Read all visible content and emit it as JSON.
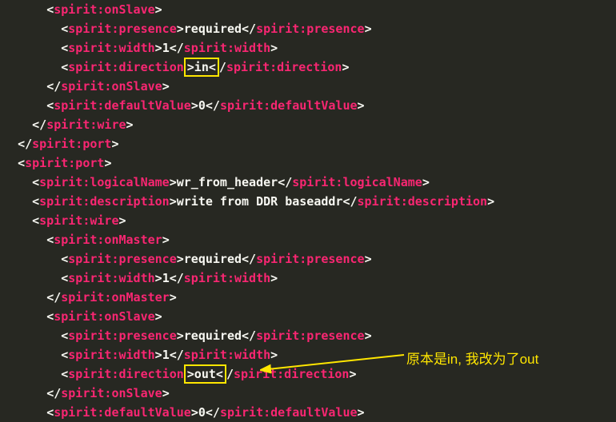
{
  "lines": {
    "l01": "spirit:onSlave",
    "l02_open": "spirit:presence",
    "l02_text": "required",
    "l02_close": "spirit:presence",
    "l03_open": "spirit:width",
    "l03_text": "1",
    "l03_close": "spirit:width",
    "l04_open": "spirit:direction",
    "l04_hl": ">in<",
    "l04_close": "spirit:direction",
    "l05": "spirit:onSlave",
    "l06_open": "spirit:defaultValue",
    "l06_text": "0",
    "l06_close": "spirit:defaultValue",
    "l07": "spirit:wire",
    "l08": "spirit:port",
    "l09": "spirit:port",
    "l10_open": "spirit:logicalName",
    "l10_text": "wr_from_header",
    "l10_close": "spirit:logicalName",
    "l11_open": "spirit:description",
    "l11_text": "write from DDR baseaddr",
    "l11_close": "spirit:description",
    "l12": "spirit:wire",
    "l13": "spirit:onMaster",
    "l14_open": "spirit:presence",
    "l14_text": "required",
    "l14_close": "spirit:presence",
    "l15_open": "spirit:width",
    "l15_text": "1",
    "l15_close": "spirit:width",
    "l16": "spirit:onMaster",
    "l17": "spirit:onSlave",
    "l18_open": "spirit:presence",
    "l18_text": "required",
    "l18_close": "spirit:presence",
    "l19_open": "spirit:width",
    "l19_text": "1",
    "l19_close": "spirit:width",
    "l20_open": "spirit:direction",
    "l20_hl": ">out<",
    "l20_close": "spirit:direction",
    "l21": "spirit:onSlave",
    "l22_open": "spirit:defaultValue",
    "l22_text": "0",
    "l22_close": "spirit:defaultValue"
  },
  "annotation": "原本是in, 我改为了out"
}
